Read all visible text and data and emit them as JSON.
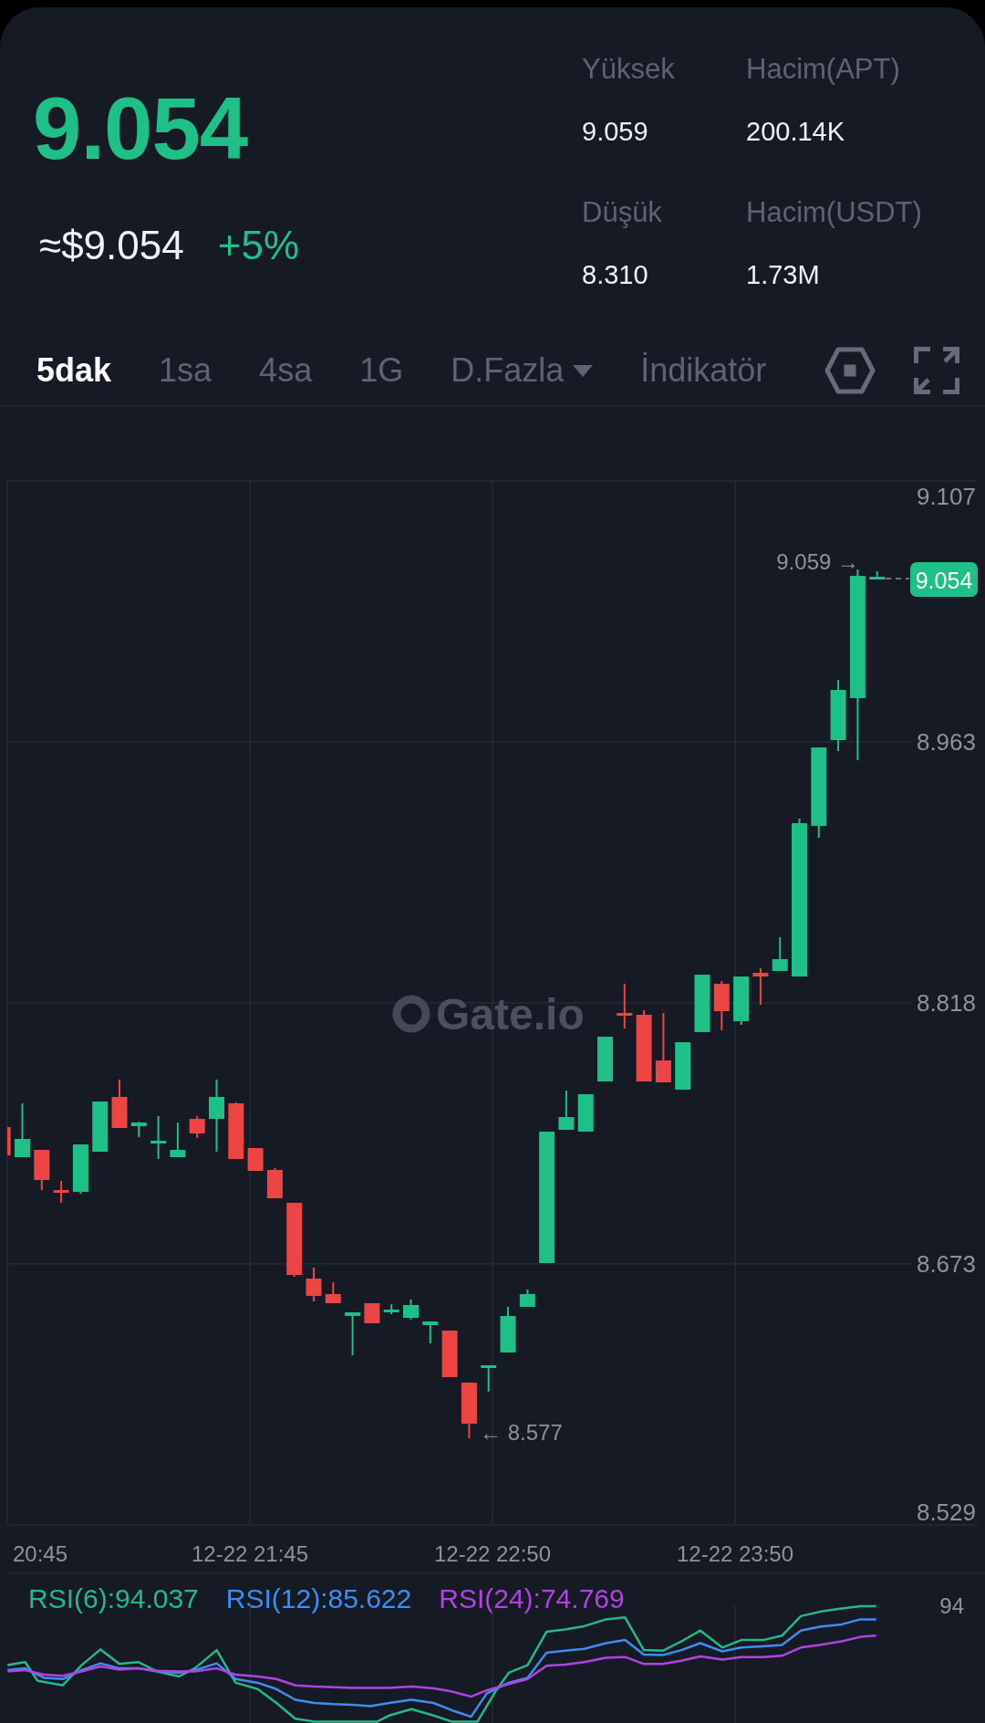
{
  "ticker": {
    "price": "9.054",
    "fiat_price": "≈$9.054",
    "change": "+5%"
  },
  "stats": [
    {
      "label": "Yüksek",
      "value": "9.059"
    },
    {
      "label": "Hacim(APT)",
      "value": "200.14K"
    },
    {
      "label": "Düşük",
      "value": "8.310"
    },
    {
      "label": "Hacim(USDT)",
      "value": "1.73M"
    }
  ],
  "toolbar": {
    "intervals": [
      {
        "label": "5dak",
        "selected": true
      },
      {
        "label": "1sa",
        "selected": false
      },
      {
        "label": "4sa",
        "selected": false
      },
      {
        "label": "1G",
        "selected": false
      }
    ],
    "more_menu": "D.Fazla",
    "indicator_menu": "İndikatör"
  },
  "price_chart": {
    "watermark": "Gate.io",
    "price_ticks": [
      "9.107",
      "8.963",
      "8.818",
      "8.673",
      "8.529"
    ],
    "time_ticks": [
      "20:45",
      "12-22 21:45",
      "12-22 22:50",
      "12-22 23:50"
    ],
    "high_marker": "9.059 →",
    "low_marker": "← 8.577",
    "current_price_tag": "9.054"
  },
  "rsi": {
    "legend": [
      {
        "label": "RSI(6):94.037",
        "color": "#22bb88"
      },
      {
        "label": "RSI(12):85.622",
        "color": "#3d8ef0"
      },
      {
        "label": "RSI(24):74.769",
        "color": "#b044e2"
      }
    ],
    "scale_label": "94"
  }
}
